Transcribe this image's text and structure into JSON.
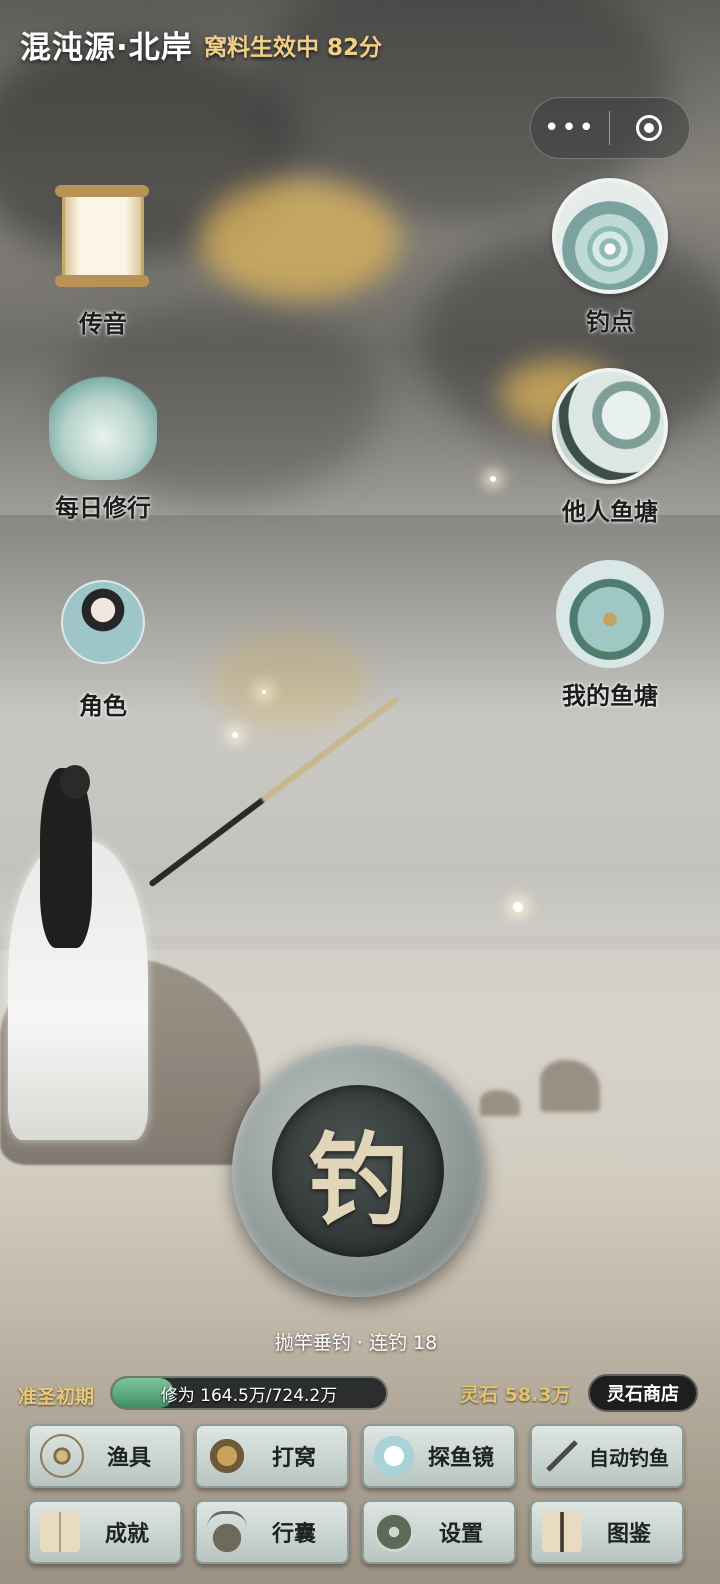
{
  "header": {
    "location": "混沌源·北岸",
    "bait_status": "窝料生效中 82分"
  },
  "capsule": {
    "more_icon": "more-dots-icon",
    "close_icon": "target-circle-icon"
  },
  "left_menu": [
    {
      "label": "传音",
      "icon": "scroll-speaker-icon"
    },
    {
      "label": "每日修行",
      "icon": "mountain-incense-icon"
    },
    {
      "label": "角色",
      "icon": "character-portrait-icon"
    }
  ],
  "right_menu": [
    {
      "label": "钓点",
      "icon": "fishing-spot-icon"
    },
    {
      "label": "他人鱼塘",
      "icon": "others-pond-icon"
    },
    {
      "label": "我的鱼塘",
      "icon": "my-pond-icon"
    }
  ],
  "fish_button": {
    "glyph": "钓"
  },
  "cast_status": "抛竿垂钓 · 连钓 18",
  "status": {
    "realm": "准圣初期",
    "xp_label": "修为 164.5万/724.2万",
    "xp_current": 164.5,
    "xp_max": 724.2,
    "spirit_stones": "灵石 58.3万",
    "shop_label": "灵石商店"
  },
  "bottom_buttons": [
    {
      "label": "渔具",
      "icon": "hook-icon"
    },
    {
      "label": "打窝",
      "icon": "bait-icon"
    },
    {
      "label": "探鱼镜",
      "icon": "lens-icon"
    },
    {
      "label": "自动钓鱼",
      "icon": "rod-icon"
    },
    {
      "label": "成就",
      "icon": "book-icon"
    },
    {
      "label": "行囊",
      "icon": "cauldron-icon"
    },
    {
      "label": "设置",
      "icon": "coin-gear-icon"
    },
    {
      "label": "图鉴",
      "icon": "catalog-icon"
    }
  ],
  "colors": {
    "gold": "#e5c26e",
    "xp_green": "#3f8f63"
  }
}
